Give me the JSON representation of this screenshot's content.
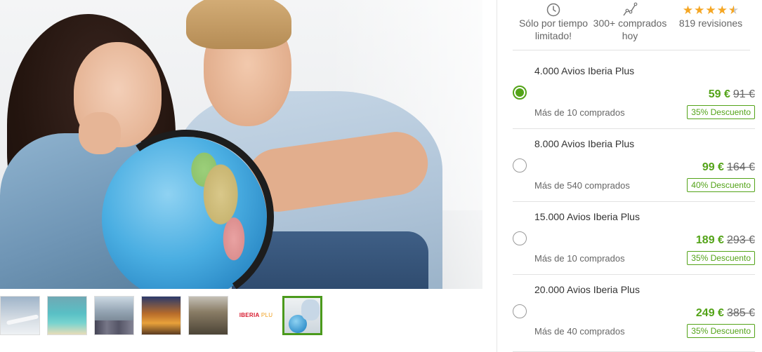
{
  "gallery": {
    "thumbnails": [
      {
        "name": "thumb-plane",
        "active": false
      },
      {
        "name": "thumb-beach",
        "active": false
      },
      {
        "name": "thumb-city",
        "active": false
      },
      {
        "name": "thumb-market",
        "active": false
      },
      {
        "name": "thumb-couple",
        "active": false
      },
      {
        "name": "thumb-iberia-logo",
        "active": false
      },
      {
        "name": "thumb-globe",
        "active": true
      }
    ],
    "logo_text": "IBERIA",
    "logo_suffix": "PLU"
  },
  "features": {
    "limited": {
      "icon": "clock-icon",
      "line1": "Sólo por tiempo",
      "line2": "limitado!"
    },
    "bought": {
      "icon": "trend-line-icon",
      "line1": "300+ comprados",
      "line2": "hoy"
    },
    "reviews": {
      "icon": "star-icon",
      "rating": 4.5,
      "text": "819 revisiones"
    }
  },
  "colors": {
    "accent": "#53a318",
    "star": "#f5a623"
  },
  "options": [
    {
      "title": "4.000 Avios Iberia Plus",
      "price": "59 €",
      "old_price": "91 €",
      "bought": "Más de 10 comprados",
      "discount": "35% Descuento",
      "selected": true
    },
    {
      "title": "8.000 Avios Iberia Plus",
      "price": "99 €",
      "old_price": "164 €",
      "bought": "Más de 540 comprados",
      "discount": "40% Descuento",
      "selected": false
    },
    {
      "title": "15.000 Avios Iberia Plus",
      "price": "189 €",
      "old_price": "293 €",
      "bought": "Más de 10 comprados",
      "discount": "35% Descuento",
      "selected": false
    },
    {
      "title": "20.000 Avios Iberia Plus",
      "price": "249 €",
      "old_price": "385 €",
      "bought": "Más de 40 comprados",
      "discount": "35% Descuento",
      "selected": false
    }
  ]
}
